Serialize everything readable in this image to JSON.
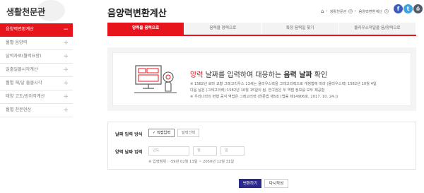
{
  "sidebar": {
    "title": "생활천문관",
    "items": [
      {
        "label": "음양력변환계산",
        "toggle": "−",
        "active": true
      },
      {
        "label": "월별 음양력",
        "toggle": "+",
        "active": false
      },
      {
        "label": "달력자료(월력요항)",
        "toggle": "+",
        "active": false
      },
      {
        "label": "일출일몰시각계산",
        "toggle": "+",
        "active": false
      },
      {
        "label": "월별 해/달 출몰시각",
        "toggle": "+",
        "active": false
      },
      {
        "label": "태양 고도/방위각계산",
        "toggle": "+",
        "active": false
      },
      {
        "label": "월별 천문현상",
        "toggle": "+",
        "active": false
      }
    ]
  },
  "header": {
    "title": "음양력변환계산",
    "breadcrumb": {
      "home_icon": "home-icon",
      "sep": "›",
      "level1": "생활천문관",
      "level2": "음양력변환계산"
    },
    "social": {
      "facebook": "f",
      "twitter": "t",
      "print": "⎙"
    }
  },
  "tabs": [
    {
      "label": "양력을 음력으로",
      "active": true
    },
    {
      "label": "음력을 양력으로",
      "active": false
    },
    {
      "label": "특정 음력일 찾기",
      "active": false
    },
    {
      "label": "율리우스적일을 음/양력으로",
      "active": false
    }
  ],
  "info": {
    "headline_red": "양력",
    "headline_mid": " 날짜를 입력하여 대응하는 ",
    "headline_bold": "음력 날짜",
    "headline_end": " 확인",
    "notes": [
      "※ 1582년 로마 교황 그레고리우스 13세는 율리우스력을 그레고리력으로 개정함에 따라 (율리우스력) 1582년 10월 4일",
      "다음 날은 (그레고리력) 1582년 10월 15일이 됨. 연구원은 두 역법 정보를 모두 제공함",
      "※ 우리나라의 현행 공식 역법은 그레고리력 (천문법 제5조 [법률 제14906호, 2017. 10. 24.])"
    ]
  },
  "form": {
    "method_label": "날짜 입력 방식",
    "method_direct": "✓ 직접입력",
    "method_select": "달력선택",
    "date_label": "양력 날짜 입력",
    "year_placeholder": "년도",
    "month_placeholder": "월",
    "day_placeholder": "일",
    "range_note": "※ 입력범위 : -59년 02월 13일 ~ 2050년 12월 31일"
  },
  "buttons": {
    "convert": "변환하기",
    "reset": "다시작성"
  },
  "colors": {
    "accent": "#e8141b",
    "primary_button": "#2a2a8c",
    "facebook": "#3b5bbd",
    "twitter": "#3aa3e6"
  }
}
